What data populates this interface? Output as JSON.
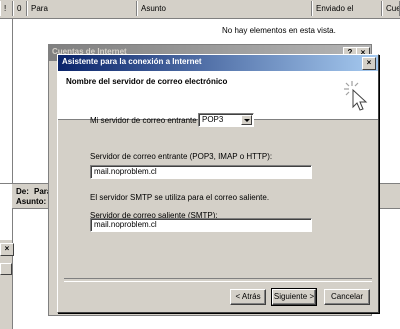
{
  "list": {
    "columns": [
      "!",
      "0",
      "Para",
      "Asunto",
      "Enviado el",
      "Cue"
    ],
    "empty_message": "No hay elementos en esta vista."
  },
  "preview": {
    "to_label": "De:",
    "to_value": "Para",
    "subject_label": "Asunto:"
  },
  "back_dialog": {
    "title": "Cuentas de Internet"
  },
  "wizard": {
    "title": "Asistente para la conexión a Internet",
    "banner_title": "Nombre del servidor de correo electrónico",
    "incoming_type_label": "Mi servidor de correo entrante es",
    "incoming_type_value": "POP3",
    "incoming_server_label": "Servidor de correo entrante (POP3, IMAP o HTTP):",
    "incoming_server_value": "mail.noproblem.cl",
    "smtp_note": "El servidor SMTP se utiliza para el correo saliente.",
    "outgoing_server_label": "Servidor de correo saliente (SMTP):",
    "outgoing_server_value": "mail.noproblem.cl",
    "back_button": "< Atrás",
    "next_button": "Siguiente >",
    "cancel_button": "Cancelar"
  },
  "title_buttons": {
    "help": "?",
    "close": "×"
  }
}
